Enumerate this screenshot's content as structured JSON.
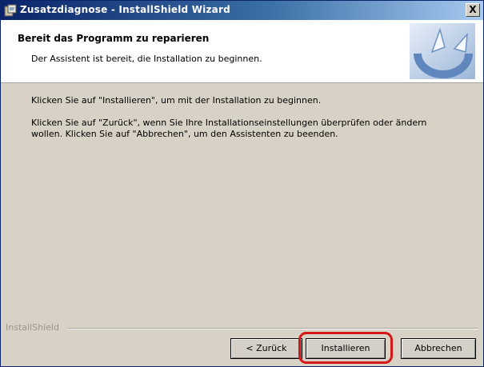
{
  "window": {
    "title": "Zusatzdiagnose - InstallShield Wizard",
    "close_label": "X"
  },
  "header": {
    "title": "Bereit das Programm zu reparieren",
    "subtitle": "Der Assistent ist bereit, die Installation zu beginnen."
  },
  "content": {
    "paragraph1": "Klicken Sie auf \"Installieren\", um mit der Installation zu beginnen.",
    "paragraph2": "Klicken Sie auf \"Zurück\", wenn Sie Ihre Installationseinstellungen überprüfen oder ändern wollen. Klicken Sie auf \"Abbrechen\", um den Assistenten zu beenden."
  },
  "footer": {
    "brand": "InstallShield",
    "buttons": {
      "back": "< Zurück",
      "install": "Installieren",
      "cancel": "Abbrechen"
    }
  },
  "colors": {
    "titlebar_start": "#0a246a",
    "titlebar_end": "#a6caf0",
    "dialog_bg": "#d8d2c6",
    "highlight": "#d41818"
  },
  "icons": [
    "installshield-app-icon",
    "close-icon",
    "installshield-logo"
  ]
}
